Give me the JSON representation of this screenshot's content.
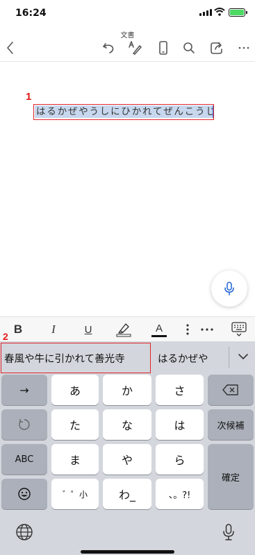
{
  "status": {
    "time": "16:24"
  },
  "toolbar": {
    "doc_title": "文書"
  },
  "document": {
    "marker_1": "1",
    "text": "はるかぜやうしにひかれてぜんこうじ"
  },
  "format_bar": {
    "bold": "B",
    "italic": "I",
    "underline": "U",
    "font_color": "A"
  },
  "keyboard": {
    "marker_2": "2",
    "suggestions": [
      "春風や牛に引かれて善光寺",
      "はるかぜや"
    ],
    "rows": [
      [
        "→",
        "あ",
        "か",
        "さ",
        "⌫"
      ],
      [
        "↺",
        "た",
        "な",
        "は",
        "次候補"
      ],
      [
        "ABC",
        "ま",
        "や",
        "ら",
        "確定"
      ],
      [
        "☺",
        "゛゜小",
        "わ_",
        "、。?!"
      ]
    ],
    "keys": {
      "arrow": "→",
      "a": "あ",
      "ka": "か",
      "sa": "さ",
      "ta": "た",
      "na": "な",
      "ha": "は",
      "next_candidate": "次候補",
      "abc": "ABC",
      "ma": "ま",
      "ya": "や",
      "ra": "ら",
      "confirm": "確定",
      "dakuten": "゛゜小",
      "wa": "わ_",
      "punct": "、。?!"
    }
  },
  "colors": {
    "highlight_border": "#e0242a",
    "selection": "#c7d7ee",
    "keyboard_bg": "#d3d6dc",
    "accent_blue": "#2a6ad8"
  }
}
